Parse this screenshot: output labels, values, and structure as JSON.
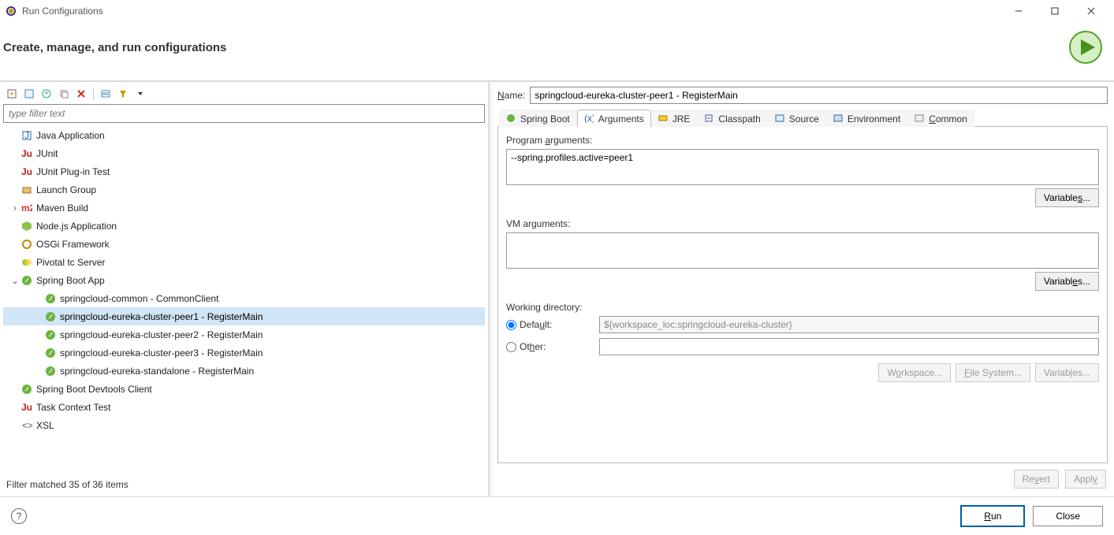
{
  "window": {
    "title": "Run Configurations",
    "heading": "Create, manage, and run configurations"
  },
  "filter": {
    "placeholder": "type filter text"
  },
  "tree": {
    "items": [
      {
        "icon": "java",
        "label": "Java Application"
      },
      {
        "icon": "junit",
        "label": "JUnit"
      },
      {
        "icon": "junit",
        "label": "JUnit Plug-in Test"
      },
      {
        "icon": "launch",
        "label": "Launch Group"
      },
      {
        "icon": "maven",
        "label": "Maven Build",
        "twisty": ">"
      },
      {
        "icon": "node",
        "label": "Node.js Application"
      },
      {
        "icon": "osgi",
        "label": "OSGi Framework"
      },
      {
        "icon": "pivotal",
        "label": "Pivotal tc Server"
      },
      {
        "icon": "spring",
        "label": "Spring Boot App",
        "twisty": "v"
      }
    ],
    "children": [
      {
        "icon": "spring",
        "label": "springcloud-common - CommonClient"
      },
      {
        "icon": "spring",
        "label": "springcloud-eureka-cluster-peer1 - RegisterMain",
        "selected": true
      },
      {
        "icon": "spring",
        "label": "springcloud-eureka-cluster-peer2 - RegisterMain"
      },
      {
        "icon": "spring",
        "label": "springcloud-eureka-cluster-peer3 - RegisterMain"
      },
      {
        "icon": "spring",
        "label": "springcloud-eureka-standalone - RegisterMain"
      }
    ],
    "after": [
      {
        "icon": "spring",
        "label": "Spring Boot Devtools Client"
      },
      {
        "icon": "task",
        "label": "Task Context Test"
      },
      {
        "icon": "xsl",
        "label": "XSL"
      }
    ],
    "status": "Filter matched 35 of 36 items"
  },
  "config": {
    "name_label": "Name:",
    "name_value": "springcloud-eureka-cluster-peer1 - RegisterMain"
  },
  "tabs": [
    {
      "id": "spring",
      "label": "Spring Boot"
    },
    {
      "id": "arguments",
      "label": "Arguments",
      "active": true
    },
    {
      "id": "jre",
      "label": "JRE"
    },
    {
      "id": "classpath",
      "label": "Classpath"
    },
    {
      "id": "source",
      "label": "Source"
    },
    {
      "id": "environment",
      "label": "Environment"
    },
    {
      "id": "common",
      "label": "Common"
    }
  ],
  "arguments": {
    "program_label": "Program arguments:",
    "program_value": "--spring.profiles.active=peer1",
    "vm_label": "VM arguments:",
    "vm_value": "",
    "variables_btn": "Variables...",
    "wd_label": "Working directory:",
    "wd_default_label": "Default:",
    "wd_default_value": "${workspace_loc:springcloud-eureka-cluster}",
    "wd_other_label": "Other:",
    "wd_other_value": "",
    "workspace_btn": "Workspace...",
    "filesystem_btn": "File System...",
    "variables2_btn": "Variables..."
  },
  "buttons": {
    "revert": "Revert",
    "apply": "Apply",
    "run": "Run",
    "close": "Close"
  }
}
